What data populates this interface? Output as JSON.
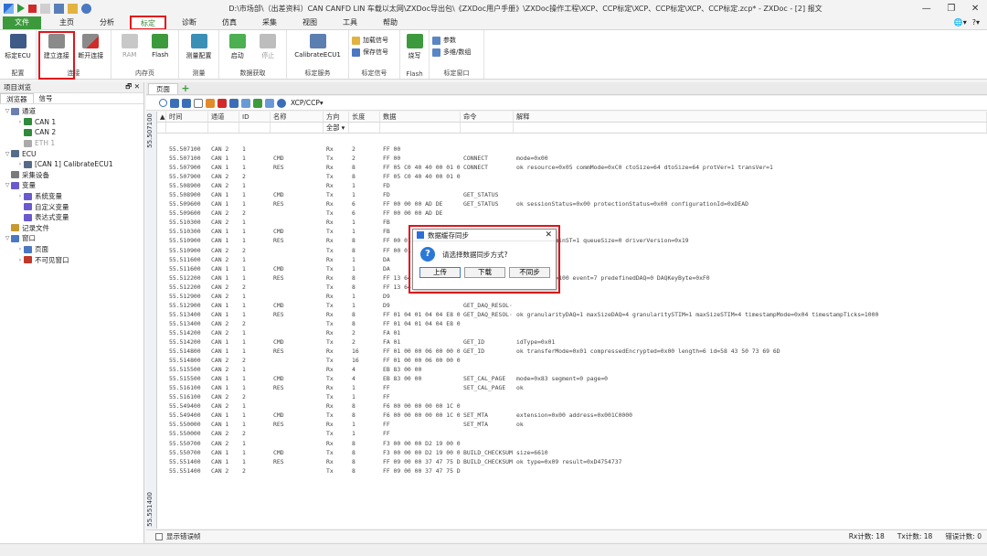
{
  "window": {
    "title": "D:\\市场部\\（出差资料）CAN CANFD LIN 车载以太网\\ZXDoc导出包\\《ZXDoc用户手册》\\ZXDoc操作工程\\XCP、CCP标定\\XCP、CCP标定\\XCP、CCP标定.zcp* - ZXDoc - [2] 报文",
    "controls": [
      "—",
      "❐",
      "✕"
    ]
  },
  "ribbon_tabs": [
    "文件",
    "主页",
    "分析",
    "标定",
    "诊断",
    "仿真",
    "采集",
    "视图",
    "工具",
    "帮助"
  ],
  "ribbon_right": [
    "🌐▾",
    "?▾"
  ],
  "ribbon_groups": [
    {
      "label": "配置",
      "buttons": [
        "标定ECU"
      ]
    },
    {
      "label": "连接",
      "buttons": [
        "建立连接",
        "断开连接"
      ]
    },
    {
      "label": "内存页",
      "buttons": [
        "RAM",
        "Flash"
      ]
    },
    {
      "label": "测量",
      "buttons": [
        "测量配置"
      ]
    },
    {
      "label": "数据获取",
      "buttons": [
        "启动",
        "停止"
      ]
    },
    {
      "label": "标定服务",
      "buttons": [
        "CalibrateECU1"
      ]
    },
    {
      "label": "标定信号",
      "buttons": [
        "加载信号",
        "保存信号"
      ]
    },
    {
      "label": "Flash",
      "buttons": [
        "烧写"
      ]
    },
    {
      "label": "标定窗口",
      "buttons": [
        "参数",
        "多维/数组"
      ]
    }
  ],
  "left_panel": {
    "title": "项目浏览",
    "controls": "🗗 ✕",
    "tabs": [
      "浏览器",
      "信号"
    ],
    "tree": [
      {
        "level": 0,
        "twisty": "▽",
        "label": "通道",
        "color": "#6b7fb0"
      },
      {
        "level": 1,
        "twisty": "›",
        "label": "CAN 1",
        "color": "#2f8a3a"
      },
      {
        "level": 1,
        "twisty": "",
        "label": "CAN 2",
        "color": "#2f8a3a"
      },
      {
        "level": 1,
        "twisty": "",
        "label": "ETH 1",
        "color": "#aaaaaa",
        "dim": true
      },
      {
        "level": 0,
        "twisty": "▽",
        "label": "ECU",
        "color": "#556b8a"
      },
      {
        "level": 1,
        "twisty": "›",
        "label": "[CAN 1] CalibrateECU1",
        "color": "#556b8a"
      },
      {
        "level": 0,
        "twisty": "",
        "label": "采集设备",
        "color": "#7a7a7a"
      },
      {
        "level": 0,
        "twisty": "▽",
        "label": "变量",
        "color": "#6a5acd"
      },
      {
        "level": 1,
        "twisty": "›",
        "label": "系统变量",
        "color": "#6a5acd"
      },
      {
        "level": 1,
        "twisty": "",
        "label": "自定义变量",
        "color": "#6a5acd"
      },
      {
        "level": 1,
        "twisty": "",
        "label": "表达式变量",
        "color": "#6a5acd"
      },
      {
        "level": 0,
        "twisty": "",
        "label": "记录文件",
        "color": "#c69a2e"
      },
      {
        "level": 0,
        "twisty": "▽",
        "label": "窗口",
        "color": "#4a78c2"
      },
      {
        "level": 1,
        "twisty": "›",
        "label": "页面",
        "color": "#4a78c2"
      },
      {
        "level": 1,
        "twisty": "›",
        "label": "不可见窗口",
        "color": "#c0392b"
      }
    ]
  },
  "doc_tabs": [
    "页面"
  ],
  "toolbar": {
    "protocol": "XCP/CCP▾"
  },
  "grid": {
    "vlabel_top": "55.507100",
    "vlabel_bottom": "55.551400",
    "sort_glyph": "▲",
    "headers": [
      "时间",
      "通道",
      "ID",
      "名称",
      "方向",
      "长度",
      "数据",
      "命令",
      "解释"
    ],
    "dir_filter": "全部",
    "rows": [
      [
        "55.507100",
        "CAN 2",
        "1",
        "",
        "Rx",
        "2",
        "FF 00",
        "",
        ""
      ],
      [
        "55.507100",
        "CAN 1",
        "1",
        "CMD",
        "Tx",
        "2",
        "FF 00",
        "CONNECT",
        "mode=0x00"
      ],
      [
        "55.507900",
        "CAN 1",
        "1",
        "RES",
        "Rx",
        "8",
        "FF 05 C0 40 40 00 01 01",
        "CONNECT",
        "ok resource=0x05 commMode=0xC0 ctoSize=64 dtoSize=64 protVer=1 transVer=1"
      ],
      [
        "55.507900",
        "CAN 2",
        "2",
        "",
        "Tx",
        "8",
        "FF 05 C0 40 40 00 01 01",
        "",
        ""
      ],
      [
        "55.508900",
        "CAN 2",
        "1",
        "",
        "Rx",
        "1",
        "FD",
        "",
        ""
      ],
      [
        "55.508900",
        "CAN 1",
        "1",
        "CMD",
        "Tx",
        "1",
        "FD",
        "GET_STATUS",
        ""
      ],
      [
        "55.509600",
        "CAN 1",
        "1",
        "RES",
        "Rx",
        "6",
        "FF 00 00 00 AD DE",
        "GET_STATUS",
        "ok sessionStatus=0x00 protectionStatus=0x00 configurationId=0xDEAD"
      ],
      [
        "55.509600",
        "CAN 2",
        "2",
        "",
        "Tx",
        "6",
        "FF 00 00 00 AD DE",
        "",
        ""
      ],
      [
        "55.510300",
        "CAN 2",
        "1",
        "",
        "Rx",
        "1",
        "FB",
        "",
        ""
      ],
      [
        "55.510300",
        "CAN 1",
        "1",
        "CMD",
        "Tx",
        "1",
        "FB",
        "",
        ""
      ],
      [
        "55.510900",
        "CAN 1",
        "1",
        "RES",
        "Rx",
        "8",
        "FF 00 01 00",
        "",
        "ok maxBS=8 minST=1 queueSize=0 driverVersion=0x19"
      ],
      [
        "55.510900",
        "CAN 2",
        "2",
        "",
        "Tx",
        "8",
        "FF 00 01 00",
        "",
        ""
      ],
      [
        "55.511600",
        "CAN 2",
        "1",
        "",
        "Rx",
        "1",
        "DA",
        "",
        ""
      ],
      [
        "55.511600",
        "CAN 1",
        "1",
        "CMD",
        "Tx",
        "1",
        "DA",
        "",
        ""
      ],
      [
        "55.512200",
        "CAN 1",
        "1",
        "RES",
        "Rx",
        "8",
        "FF 13 64 00",
        "",
        "ok 2 maxDAQ=100 event=7 predefinedDAQ=0 DAQKeyByte=0xF0"
      ],
      [
        "55.512200",
        "CAN 2",
        "2",
        "",
        "Tx",
        "8",
        "FF 13 64 00",
        "",
        ""
      ],
      [
        "55.512900",
        "CAN 2",
        "1",
        "",
        "Rx",
        "1",
        "D9",
        "",
        ""
      ],
      [
        "55.512900",
        "CAN 1",
        "1",
        "CMD",
        "Tx",
        "1",
        "D9",
        "GET_DAQ_RESOL···",
        ""
      ],
      [
        "55.513400",
        "CAN 1",
        "1",
        "RES",
        "Rx",
        "8",
        "FF 01 04 01 04 04 E8 03",
        "GET_DAQ_RESOL···",
        "ok granularityDAQ=1 maxSizeDAQ=4 granularitySTIM=1 maxSizeSTIM=4 timestampMode=0x04 timestampTicks=1000"
      ],
      [
        "55.513400",
        "CAN 2",
        "2",
        "",
        "Tx",
        "8",
        "FF 01 04 01 04 04 E8 03",
        "",
        ""
      ],
      [
        "55.514200",
        "CAN 2",
        "1",
        "",
        "Rx",
        "2",
        "FA 01",
        "",
        ""
      ],
      [
        "55.514200",
        "CAN 1",
        "1",
        "CMD",
        "Tx",
        "2",
        "FA 01",
        "GET_ID",
        "idType=0x01"
      ],
      [
        "55.514800",
        "CAN 1",
        "1",
        "RES",
        "Rx",
        "16",
        "FF 01 00 00 06 00 00 00 ···",
        "GET_ID",
        "ok transferMode=0x01 compressedEncrypted=0x00 length=6 id=58 43 50 73 69 6D"
      ],
      [
        "55.514800",
        "CAN 2",
        "2",
        "",
        "Tx",
        "16",
        "FF 01 00 00 06 00 00 00 ···",
        "",
        ""
      ],
      [
        "55.515500",
        "CAN 2",
        "1",
        "",
        "Rx",
        "4",
        "EB 83 00 00",
        "",
        ""
      ],
      [
        "55.515500",
        "CAN 1",
        "1",
        "CMD",
        "Tx",
        "4",
        "EB 83 00 00",
        "SET_CAL_PAGE",
        "mode=0x83 segment=0 page=0"
      ],
      [
        "55.516100",
        "CAN 1",
        "1",
        "RES",
        "Rx",
        "1",
        "FF",
        "SET_CAL_PAGE",
        "ok"
      ],
      [
        "55.516100",
        "CAN 2",
        "2",
        "",
        "Tx",
        "1",
        "FF",
        "",
        ""
      ],
      [
        "55.549400",
        "CAN 2",
        "1",
        "",
        "Rx",
        "8",
        "F6 00 00 00 00 00 1C 00",
        "",
        ""
      ],
      [
        "55.549400",
        "CAN 1",
        "1",
        "CMD",
        "Tx",
        "8",
        "F6 00 00 00 00 00 1C 00",
        "SET_MTA",
        "extension=0x00 address=0x001C0000"
      ],
      [
        "55.550000",
        "CAN 1",
        "1",
        "RES",
        "Rx",
        "1",
        "FF",
        "SET_MTA",
        "ok"
      ],
      [
        "55.550000",
        "CAN 2",
        "2",
        "",
        "Tx",
        "1",
        "FF",
        "",
        ""
      ],
      [
        "55.550700",
        "CAN 2",
        "1",
        "",
        "Rx",
        "8",
        "F3 00 00 00 D2 19 00 00",
        "",
        ""
      ],
      [
        "55.550700",
        "CAN 1",
        "1",
        "CMD",
        "Tx",
        "8",
        "F3 00 00 00 D2 19 00 00",
        "BUILD_CHECKSUM",
        "size=6610"
      ],
      [
        "55.551400",
        "CAN 1",
        "1",
        "RES",
        "Rx",
        "8",
        "FF 09 00 00 37 47 75 D4",
        "BUILD_CHECKSUM",
        "ok type=0x09 result=0xD4754737"
      ],
      [
        "55.551400",
        "CAN 2",
        "2",
        "",
        "Tx",
        "8",
        "FF 09 00 00 37 47 75 D4",
        "",
        ""
      ]
    ]
  },
  "status": {
    "checkbox": "显示错误帧",
    "rx": "Rx计数: 18",
    "tx": "Tx计数: 18",
    "err": "错误计数: 0"
  },
  "dialog": {
    "title": "数据缓存同步",
    "close": "✕",
    "question_glyph": "?",
    "message": "请选择数据同步方式?",
    "buttons": [
      "上传",
      "下载",
      "不同步"
    ]
  },
  "colors": {
    "accent": "#3c9a3c",
    "highlight": "#e0141b",
    "info": "#2b78d6"
  }
}
